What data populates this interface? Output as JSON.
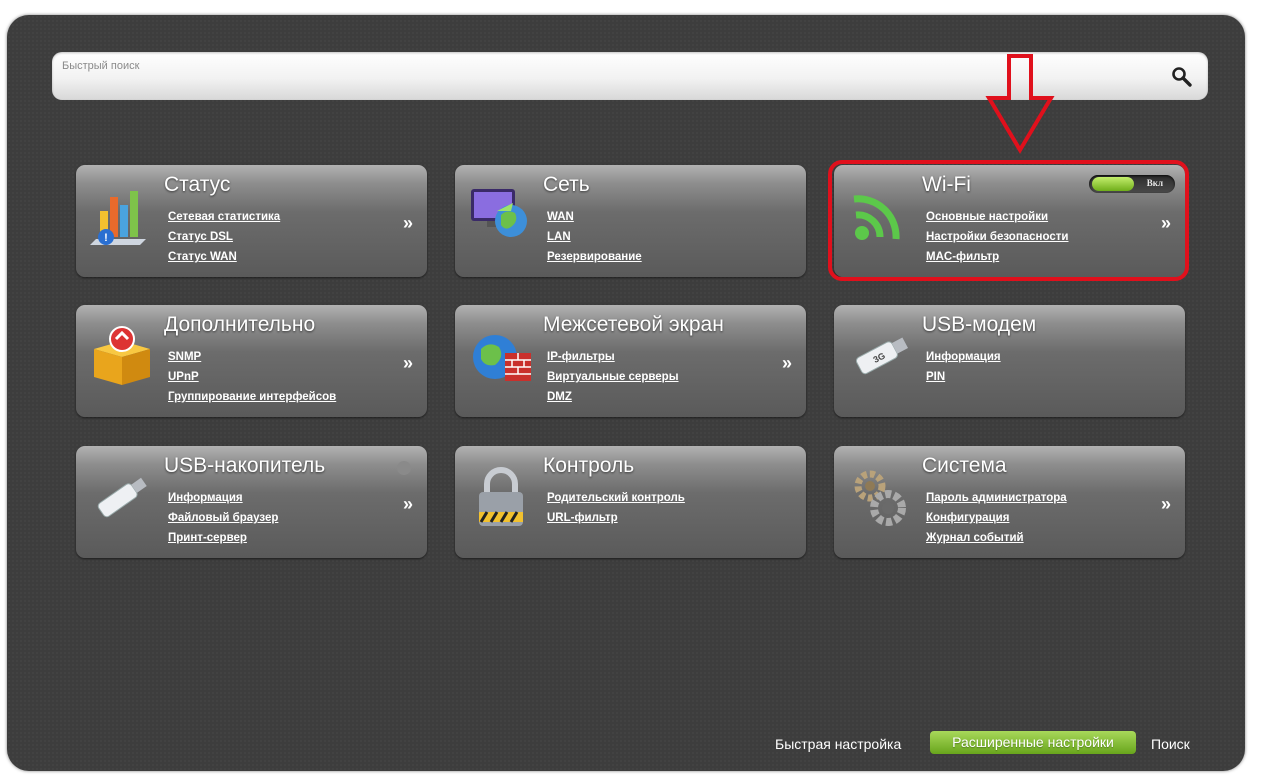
{
  "search": {
    "placeholder": "Быстрый поиск"
  },
  "cards": {
    "status": {
      "title": "Статус",
      "links": [
        "Сетевая статистика",
        "Статус DSL",
        "Статус WAN"
      ],
      "arrow": "»"
    },
    "network": {
      "title": "Сеть",
      "links": [
        "WAN",
        "LAN",
        "Резервирование"
      ]
    },
    "wifi": {
      "title": "Wi-Fi",
      "links": [
        "Основные настройки",
        "Настройки безопасности",
        "MAC-фильтр"
      ],
      "arrow": "»",
      "toggle_label": "Вкл",
      "toggle_on": true
    },
    "advanced": {
      "title": "Дополнительно",
      "links": [
        "SNMP",
        "UPnP",
        "Группирование интерфейсов"
      ],
      "arrow": "»"
    },
    "firewall": {
      "title": "Межсетевой экран",
      "links": [
        "IP-фильтры",
        "Виртуальные серверы",
        "DMZ"
      ],
      "arrow": "»"
    },
    "usb_modem": {
      "title": "USB-модем",
      "links": [
        "Информация",
        "PIN"
      ]
    },
    "usb_storage": {
      "title": "USB-накопитель",
      "links": [
        "Информация",
        "Файловый браузер",
        "Принт-сервер"
      ],
      "arrow": "»"
    },
    "control": {
      "title": "Контроль",
      "links": [
        "Родительский контроль",
        "URL-фильтр"
      ]
    },
    "system": {
      "title": "Система",
      "links": [
        "Пароль администратора",
        "Конфигурация",
        "Журнал событий"
      ],
      "arrow": "»"
    }
  },
  "bottom": {
    "quick_setup": "Быстрая настройка",
    "advanced_settings": "Расширенные настройки",
    "search": "Поиск"
  },
  "colors": {
    "accent_green": "#7fbf2a",
    "highlight_red": "#e0101c",
    "panel_bg": "#3d3d3d"
  }
}
